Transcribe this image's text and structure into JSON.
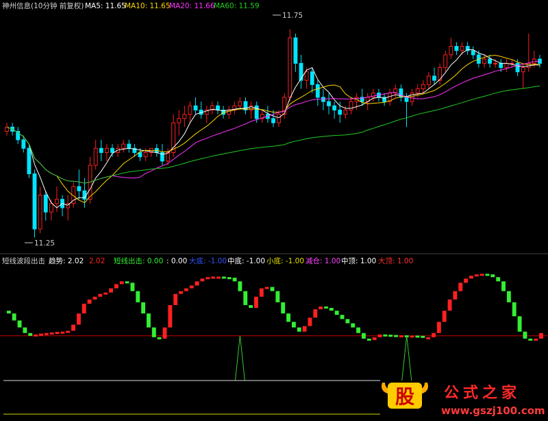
{
  "colors": {
    "up": "#ff2020",
    "down": "#00e5ff",
    "ma5": "#ffffff",
    "ma10": "#ffd700",
    "ma20": "#ff33ff",
    "ma60": "#22cc22",
    "sig_up": "#ff2020",
    "sig_down": "#33ee33",
    "redline": "#cc0000",
    "green": "#33cc33",
    "white": "#ffffff",
    "yellow": "#e0e000",
    "magenta": "#ff44ff",
    "blue": "#3355ff"
  },
  "header": {
    "title": "神州信息(10分钟 前复权)",
    "ma5": "MA5: 11.65",
    "ma10": "MA10: 11.65",
    "ma20": "MA20: 11.66",
    "ma60": "MA60: 11.59"
  },
  "annotations": {
    "high": "11.75",
    "low": "11.25"
  },
  "indicator": {
    "name": "短线波段出击",
    "trend_label": "趋势: 2.02",
    "trend_val": "2.02",
    "out_label": "短线出击: 0.00",
    "out_val": ": 0.00",
    "dabot": "大底: -1.00",
    "zhongdi": "中底: -1.00",
    "xiaodi": "小底: -1.00",
    "jiancang": "减仓: 1.00",
    "zhongding": "中顶: 1.00",
    "dading": "大顶: 1.00"
  },
  "watermark": {
    "logo": "股",
    "text": "公式之家",
    "url": "www.gszj100.com"
  },
  "chart_data": [
    {
      "type": "candlestick",
      "title": "神州信息(10分钟 前复权)",
      "ylim": [
        11.23,
        11.79
      ],
      "annotated_high": 11.75,
      "annotated_low": 11.25,
      "candles": [
        [
          11.51,
          11.53,
          11.5,
          11.52
        ],
        [
          11.52,
          11.53,
          11.5,
          11.51
        ],
        [
          11.51,
          11.52,
          11.48,
          11.49
        ],
        [
          11.49,
          11.5,
          11.46,
          11.47
        ],
        [
          11.47,
          11.48,
          11.4,
          11.41
        ],
        [
          11.41,
          11.42,
          11.26,
          11.28
        ],
        [
          11.28,
          11.38,
          11.27,
          11.36
        ],
        [
          11.36,
          11.37,
          11.3,
          11.32
        ],
        [
          11.32,
          11.35,
          11.3,
          11.34
        ],
        [
          11.34,
          11.38,
          11.32,
          11.35
        ],
        [
          11.35,
          11.36,
          11.31,
          11.33
        ],
        [
          11.33,
          11.36,
          11.3,
          11.34
        ],
        [
          11.34,
          11.39,
          11.33,
          11.38
        ],
        [
          11.38,
          11.42,
          11.35,
          11.37
        ],
        [
          11.37,
          11.4,
          11.33,
          11.35
        ],
        [
          11.35,
          11.45,
          11.34,
          11.43
        ],
        [
          11.43,
          11.49,
          11.42,
          11.47
        ],
        [
          11.47,
          11.49,
          11.44,
          11.46
        ],
        [
          11.46,
          11.48,
          11.44,
          11.47
        ],
        [
          11.47,
          11.48,
          11.45,
          11.46
        ],
        [
          11.46,
          11.48,
          11.45,
          11.47
        ],
        [
          11.47,
          11.49,
          11.46,
          11.48
        ],
        [
          11.48,
          11.49,
          11.46,
          11.47
        ],
        [
          11.47,
          11.48,
          11.45,
          11.46
        ],
        [
          11.46,
          11.47,
          11.44,
          11.45
        ],
        [
          11.45,
          11.47,
          11.44,
          11.46
        ],
        [
          11.46,
          11.47,
          11.45,
          11.47
        ],
        [
          11.47,
          11.48,
          11.45,
          11.46
        ],
        [
          11.46,
          11.48,
          11.43,
          11.44
        ],
        [
          11.44,
          11.47,
          11.43,
          11.46
        ],
        [
          11.46,
          11.55,
          11.45,
          11.53
        ],
        [
          11.53,
          11.56,
          11.5,
          11.54
        ],
        [
          11.54,
          11.57,
          11.52,
          11.55
        ],
        [
          11.55,
          11.58,
          11.53,
          11.57
        ],
        [
          11.57,
          11.59,
          11.55,
          11.56
        ],
        [
          11.56,
          11.58,
          11.54,
          11.55
        ],
        [
          11.55,
          11.57,
          11.53,
          11.56
        ],
        [
          11.56,
          11.58,
          11.55,
          11.57
        ],
        [
          11.57,
          11.58,
          11.55,
          11.56
        ],
        [
          11.56,
          11.57,
          11.54,
          11.55
        ],
        [
          11.55,
          11.57,
          11.54,
          11.56
        ],
        [
          11.56,
          11.58,
          11.55,
          11.57
        ],
        [
          11.57,
          11.59,
          11.56,
          11.58
        ],
        [
          11.58,
          11.59,
          11.55,
          11.56
        ],
        [
          11.56,
          11.58,
          11.54,
          11.57
        ],
        [
          11.57,
          11.58,
          11.53,
          11.54
        ],
        [
          11.54,
          11.56,
          11.53,
          11.55
        ],
        [
          11.55,
          11.57,
          11.53,
          11.54
        ],
        [
          11.54,
          11.56,
          11.52,
          11.53
        ],
        [
          11.53,
          11.56,
          11.52,
          11.55
        ],
        [
          11.55,
          11.6,
          11.54,
          11.59
        ],
        [
          11.59,
          11.75,
          11.58,
          11.73
        ],
        [
          11.73,
          11.74,
          11.65,
          11.67
        ],
        [
          11.67,
          11.69,
          11.61,
          11.63
        ],
        [
          11.63,
          11.66,
          11.61,
          11.65
        ],
        [
          11.65,
          11.66,
          11.6,
          11.62
        ],
        [
          11.62,
          11.63,
          11.57,
          11.59
        ],
        [
          11.59,
          11.61,
          11.56,
          11.58
        ],
        [
          11.58,
          11.6,
          11.55,
          11.57
        ],
        [
          11.57,
          11.58,
          11.54,
          11.56
        ],
        [
          11.56,
          11.58,
          11.53,
          11.55
        ],
        [
          11.55,
          11.57,
          11.54,
          11.56
        ],
        [
          11.56,
          11.59,
          11.55,
          11.58
        ],
        [
          11.58,
          11.6,
          11.56,
          11.59
        ],
        [
          11.59,
          11.61,
          11.57,
          11.58
        ],
        [
          11.58,
          11.6,
          11.56,
          11.59
        ],
        [
          11.59,
          11.61,
          11.58,
          11.6
        ],
        [
          11.6,
          11.61,
          11.58,
          11.59
        ],
        [
          11.59,
          11.6,
          11.57,
          11.58
        ],
        [
          11.58,
          11.61,
          11.57,
          11.6
        ],
        [
          11.6,
          11.62,
          11.59,
          11.61
        ],
        [
          11.61,
          11.62,
          11.58,
          11.59
        ],
        [
          11.59,
          11.6,
          11.52,
          11.58
        ],
        [
          11.58,
          11.61,
          11.57,
          11.6
        ],
        [
          11.6,
          11.62,
          11.59,
          11.61
        ],
        [
          11.61,
          11.63,
          11.6,
          11.62
        ],
        [
          11.62,
          11.65,
          11.61,
          11.64
        ],
        [
          11.64,
          11.66,
          11.62,
          11.63
        ],
        [
          11.63,
          11.67,
          11.62,
          11.66
        ],
        [
          11.66,
          11.7,
          11.65,
          11.69
        ],
        [
          11.69,
          11.73,
          11.68,
          11.71
        ],
        [
          11.71,
          11.72,
          11.69,
          11.7
        ],
        [
          11.7,
          11.72,
          11.69,
          11.71
        ],
        [
          11.71,
          11.72,
          11.69,
          11.7
        ],
        [
          11.7,
          11.71,
          11.68,
          11.69
        ],
        [
          11.69,
          11.7,
          11.66,
          11.67
        ],
        [
          11.67,
          11.69,
          11.66,
          11.68
        ],
        [
          11.68,
          11.69,
          11.66,
          11.67
        ],
        [
          11.67,
          11.68,
          11.66,
          11.67
        ],
        [
          11.67,
          11.68,
          11.65,
          11.66
        ],
        [
          11.66,
          11.68,
          11.65,
          11.67
        ],
        [
          11.67,
          11.68,
          11.66,
          11.67
        ],
        [
          11.67,
          11.68,
          11.64,
          11.65
        ],
        [
          11.65,
          11.67,
          11.61,
          11.66
        ],
        [
          11.66,
          11.74,
          11.65,
          11.67
        ],
        [
          11.67,
          11.7,
          11.66,
          11.68
        ],
        [
          11.68,
          11.69,
          11.66,
          11.67
        ]
      ]
    },
    {
      "type": "line",
      "title": "短线波段出击",
      "ylim": [
        -1.6,
        2.4
      ],
      "reference_line": 0,
      "signal": [
        0.9,
        0.8,
        0.55,
        0.3,
        0.1,
        0.0,
        0.05,
        0.08,
        0.1,
        0.12,
        0.14,
        0.15,
        0.18,
        0.4,
        0.8,
        1.15,
        1.3,
        1.4,
        1.5,
        1.55,
        1.7,
        1.85,
        1.95,
        1.9,
        1.6,
        1.2,
        0.8,
        0.3,
        -0.05,
        -0.1,
        0.3,
        1.1,
        1.5,
        1.6,
        1.7,
        1.8,
        1.95,
        2.05,
        2.1,
        2.12,
        2.12,
        2.1,
        2.08,
        1.95,
        1.6,
        1.1,
        1.0,
        1.4,
        1.7,
        1.75,
        1.6,
        1.2,
        0.8,
        0.5,
        0.3,
        0.15,
        0.35,
        0.65,
        0.95,
        1.05,
        1.0,
        0.9,
        0.75,
        0.6,
        0.45,
        0.3,
        0.1,
        -0.1,
        -0.15,
        -0.05,
        0.05,
        0.04,
        0.03,
        0.02,
        0.02,
        0.01,
        0.01,
        0.0,
        -0.05,
        -0.05,
        0.1,
        0.5,
        0.9,
        1.3,
        1.6,
        1.9,
        2.05,
        2.15,
        2.2,
        2.22,
        2.2,
        2.1,
        1.95,
        1.6,
        1.2,
        0.7,
        0.15,
        -0.1,
        -0.12,
        -0.1,
        0.1
      ],
      "bottom_markers": [
        {
          "x_index": 44
        },
        {
          "x_index": 75
        }
      ]
    }
  ]
}
